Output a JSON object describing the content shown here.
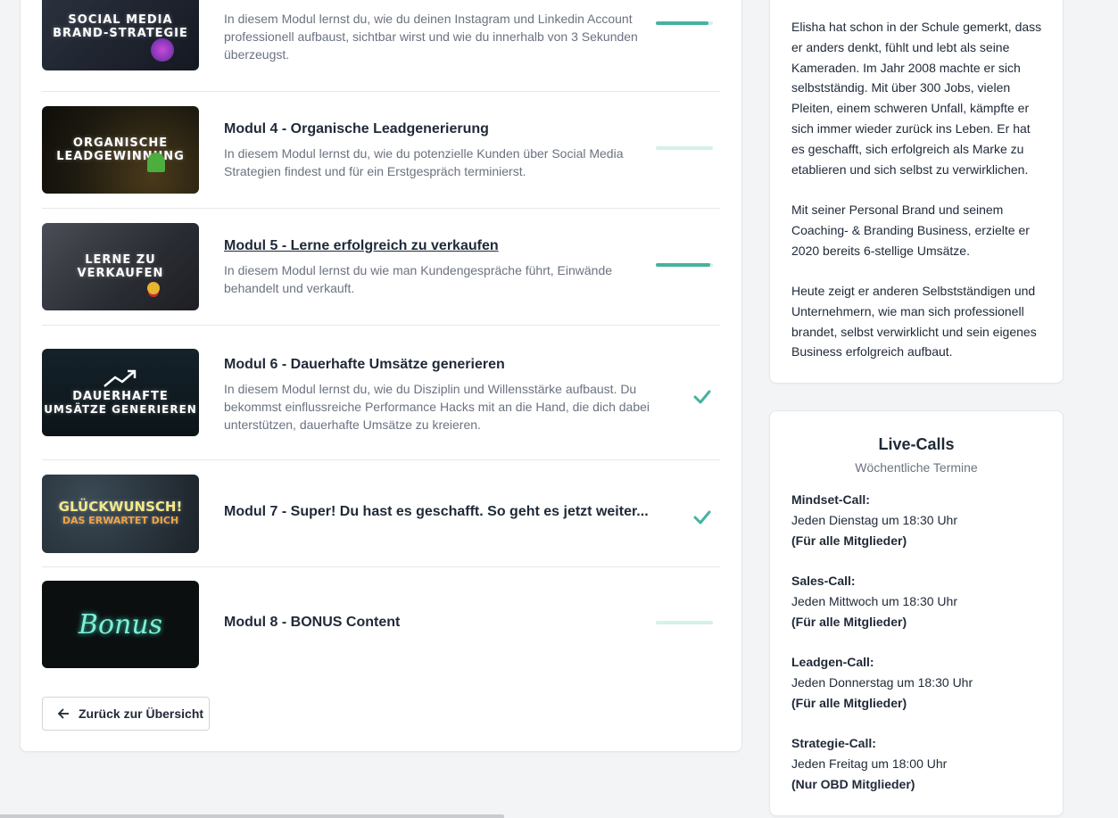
{
  "modules": [
    {
      "thumb_lines": [
        "SOCIAL MEDIA",
        "BRAND-STRATEGIE"
      ],
      "title": "",
      "description": "In diesem Modul lernst du, wie du deinen Instagram und Linkedin Account professionell aufbaust, sichtbar wirst und wie du innerhalb von 3 Sekunden überzeugst.",
      "progress": 0.92
    },
    {
      "thumb_lines": [
        "ORGANISCHE",
        "LEADGEWINNUNG"
      ],
      "title": "Modul 4 - Organische Leadgenerierung",
      "description": "In diesem Modul lernst du, wie du potenzielle Kunden über Social Media Strategien findest und für ein Erstgespräch terminierst.",
      "progress": 0
    },
    {
      "thumb_lines": [
        "LERNE ZU",
        "VERKAUFEN"
      ],
      "title": "Modul 5 - Lerne erfolgreich zu verkaufen",
      "description": "In diesem Modul lernst du wie man Kundengespräche führt, Einwände behandelt und verkauft.",
      "progress": 0.95
    },
    {
      "thumb_lines": [
        "DAUERHAFTE",
        "UMSÄTZE GENERIEREN"
      ],
      "title": "Modul 6 - Dauerhafte Umsätze generieren",
      "description": "In diesem Modul lernst du, wie du Disziplin und Willensstärke aufbaust. Du bekommst einflussreiche Performance Hacks mit an die Hand, die dich dabei unterstützen, dauerhafte Umsätze zu kreieren.",
      "completed": true
    },
    {
      "thumb_lines": [
        "GLÜCKWUNSCH!",
        "DAS ERWARTET DICH"
      ],
      "title": "Modul 7 - Super! Du hast es geschafft. So geht es jetzt weiter...",
      "completed": true
    },
    {
      "thumb_lines": [
        "Bonus"
      ],
      "title": "Modul 8 - BONUS Content",
      "progress": 0
    }
  ],
  "back_button": {
    "label": "Zurück zur Übersicht",
    "icon": "arrow-left-icon"
  },
  "bio": {
    "paragraphs": [
      "Elisha hat schon in der Schule gemerkt, dass er anders denkt, fühlt und lebt als seine Kameraden. Im Jahr 2008 machte er sich selbstständig. Mit über 300 Jobs, vielen Pleiten, einem schweren Unfall, kämpfte er sich immer wieder zurück ins Leben. Er hat es geschafft, sich erfolgreich als Marke zu etablieren und sich selbst zu verwirklichen.",
      "Mit seiner Personal Brand und seinem Coaching- & Branding Business, erzielte er 2020 bereits 6-stellige Umsätze.",
      "Heute zeigt er anderen Selbstständigen und Unternehmern, wie man sich professionell brandet, selbst verwirklicht und sein eigenes Business erfolgreich aufbaut."
    ]
  },
  "live_calls": {
    "title": "Live-Calls",
    "subtitle": "Wöchentliche Termine",
    "items": [
      {
        "name": "Mindset-Call:",
        "time": "Jeden Dienstag um 18:30 Uhr",
        "audience": "(Für alle Mitglieder)"
      },
      {
        "name": "Sales-Call:",
        "time": "Jeden Mittwoch um 18:30 Uhr",
        "audience": "(Für alle Mitglieder)"
      },
      {
        "name": "Leadgen-Call:",
        "time": "Jeden Donnerstag um 18:30 Uhr",
        "audience": "(Für alle Mitglieder)"
      },
      {
        "name": "Strategie-Call:",
        "time": "Jeden Freitag um 18:00 Uhr",
        "audience": "(Nur OBD Mitglieder)"
      }
    ]
  },
  "colors": {
    "accent": "#45b39c",
    "progress_track": "#d6f0ea"
  }
}
